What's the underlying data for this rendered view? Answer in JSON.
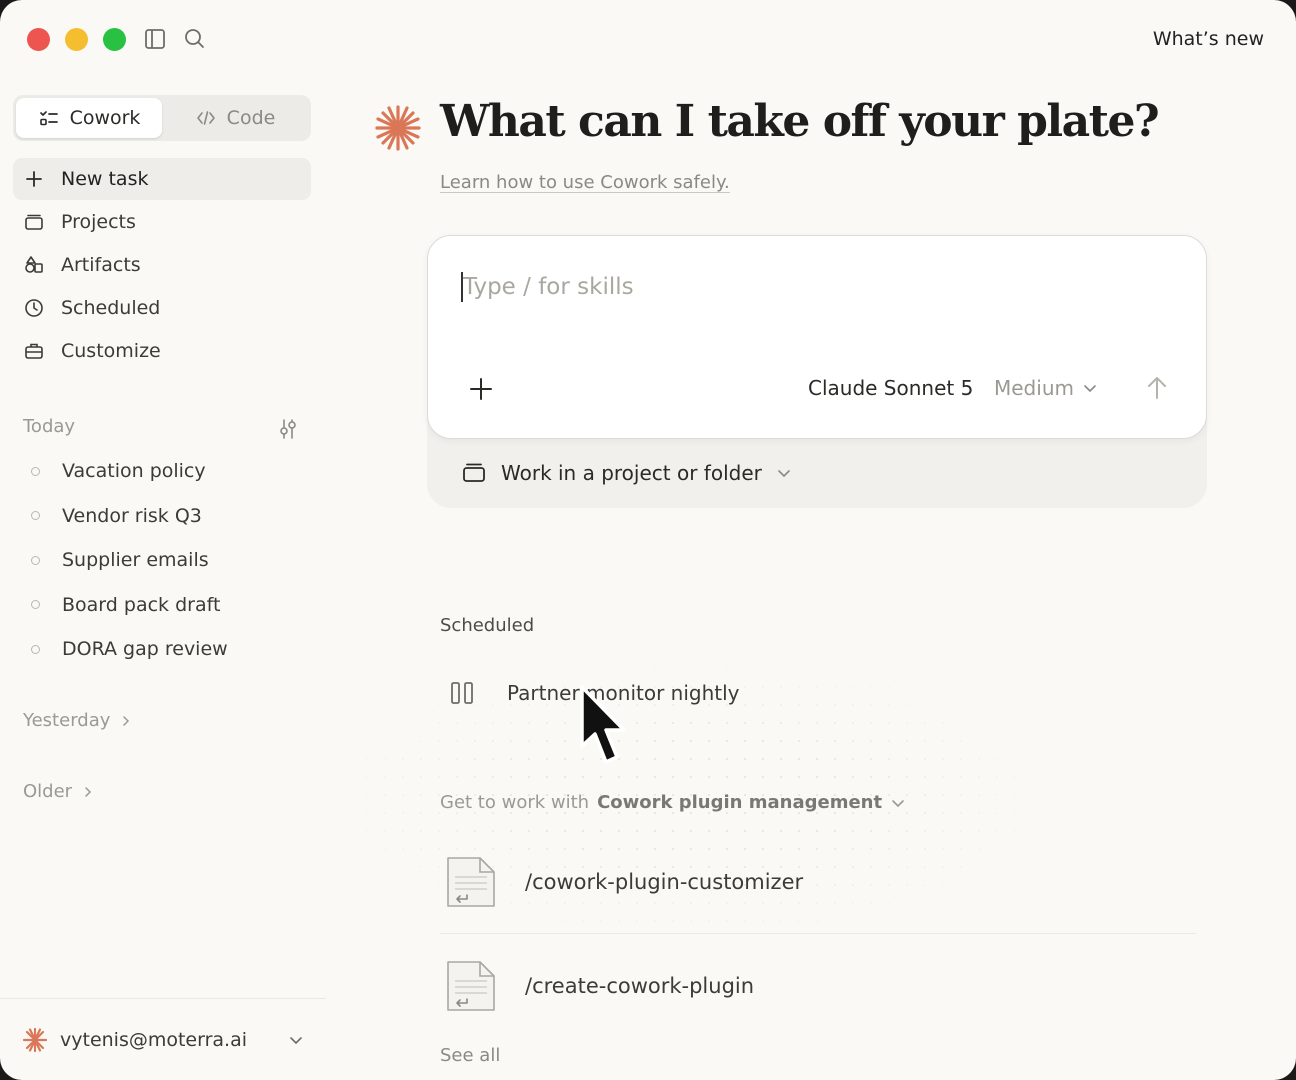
{
  "header": {
    "whats_new": "What’s new"
  },
  "sidebar": {
    "modes": [
      {
        "label": "Cowork",
        "active": true
      },
      {
        "label": "Code",
        "active": false
      }
    ],
    "nav": [
      {
        "label": "New task",
        "icon": "plus-icon"
      },
      {
        "label": "Projects",
        "icon": "projects-icon"
      },
      {
        "label": "Artifacts",
        "icon": "artifacts-icon"
      },
      {
        "label": "Scheduled",
        "icon": "clock-icon"
      },
      {
        "label": "Customize",
        "icon": "briefcase-icon"
      }
    ],
    "today_label": "Today",
    "today_items": [
      "Vacation policy",
      "Vendor risk Q3",
      "Supplier emails",
      "Board pack draft",
      "DORA gap review"
    ],
    "yesterday_label": "Yesterday",
    "older_label": "Older",
    "account_email": "vytenis@moterra.ai"
  },
  "main": {
    "title": "What can I take off your plate?",
    "safety_link": "Learn how to use Cowork safely.",
    "composer": {
      "placeholder": "Type / for skills",
      "model": "Claude Sonnet 5",
      "effort": "Medium"
    },
    "project_selector": "Work in a project or folder",
    "scheduled_label": "Scheduled",
    "scheduled_item": "Partner monitor nightly",
    "plugin_prefix": "Get to work with",
    "plugin_name": "Cowork plugin management",
    "skills": [
      "/cowork-plugin-customizer",
      "/create-cowork-plugin"
    ],
    "see_all": "See all"
  },
  "colors": {
    "accent": "#d97757",
    "background": "#faf9f6",
    "traffic_red": "#ec5550",
    "traffic_yellow": "#f4be2e",
    "traffic_green": "#28c142"
  }
}
